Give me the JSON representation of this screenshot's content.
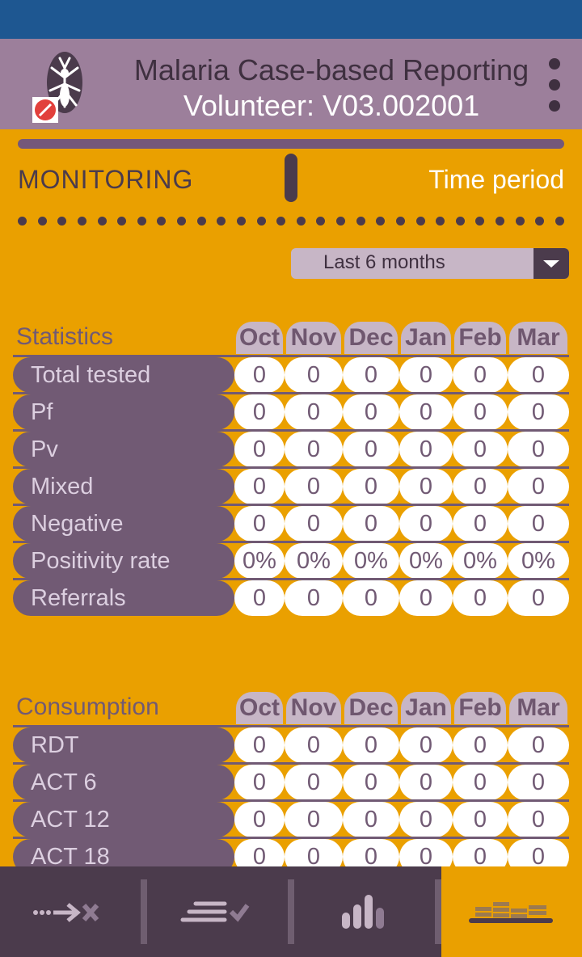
{
  "app": {
    "title": "Malaria Case-based Reporting",
    "subtitle": "Volunteer: V03.002001"
  },
  "monitor": {
    "section_label": "MONITORING",
    "period_label": "Time period",
    "period_value": "Last 6 months"
  },
  "statistics": {
    "title": "Statistics",
    "months": [
      "Oct",
      "Nov",
      "Dec",
      "Jan",
      "Feb",
      "Mar"
    ],
    "rows": [
      {
        "label": "Total tested",
        "values": [
          "0",
          "0",
          "0",
          "0",
          "0",
          "0"
        ]
      },
      {
        "label": "Pf",
        "values": [
          "0",
          "0",
          "0",
          "0",
          "0",
          "0"
        ]
      },
      {
        "label": "Pv",
        "values": [
          "0",
          "0",
          "0",
          "0",
          "0",
          "0"
        ]
      },
      {
        "label": "Mixed",
        "values": [
          "0",
          "0",
          "0",
          "0",
          "0",
          "0"
        ]
      },
      {
        "label": "Negative",
        "values": [
          "0",
          "0",
          "0",
          "0",
          "0",
          "0"
        ]
      },
      {
        "label": "Positivity rate",
        "values": [
          "0%",
          "0%",
          "0%",
          "0%",
          "0%",
          "0%"
        ]
      },
      {
        "label": "Referrals",
        "values": [
          "0",
          "0",
          "0",
          "0",
          "0",
          "0"
        ]
      }
    ]
  },
  "consumption": {
    "title": "Consumption",
    "months": [
      "Oct",
      "Nov",
      "Dec",
      "Jan",
      "Feb",
      "Mar"
    ],
    "rows": [
      {
        "label": "RDT",
        "values": [
          "0",
          "0",
          "0",
          "0",
          "0",
          "0"
        ]
      },
      {
        "label": "ACT 6",
        "values": [
          "0",
          "0",
          "0",
          "0",
          "0",
          "0"
        ]
      },
      {
        "label": "ACT 12",
        "values": [
          "0",
          "0",
          "0",
          "0",
          "0",
          "0"
        ]
      },
      {
        "label": "ACT 18",
        "values": [
          "0",
          "0",
          "0",
          "0",
          "0",
          "0"
        ]
      }
    ]
  },
  "nav": {
    "tabs": [
      {
        "icon": "arrow-cross-icon",
        "active": false
      },
      {
        "icon": "list-check-icon",
        "active": false
      },
      {
        "icon": "bar-chart-icon",
        "active": false
      },
      {
        "icon": "stock-icon",
        "active": true
      }
    ]
  },
  "colors": {
    "status_bar": "#1e5791",
    "app_bar": "#9c7f9b",
    "background": "#eaa000",
    "accent_dark": "#4b3b4c",
    "row_label": "#715a74"
  }
}
